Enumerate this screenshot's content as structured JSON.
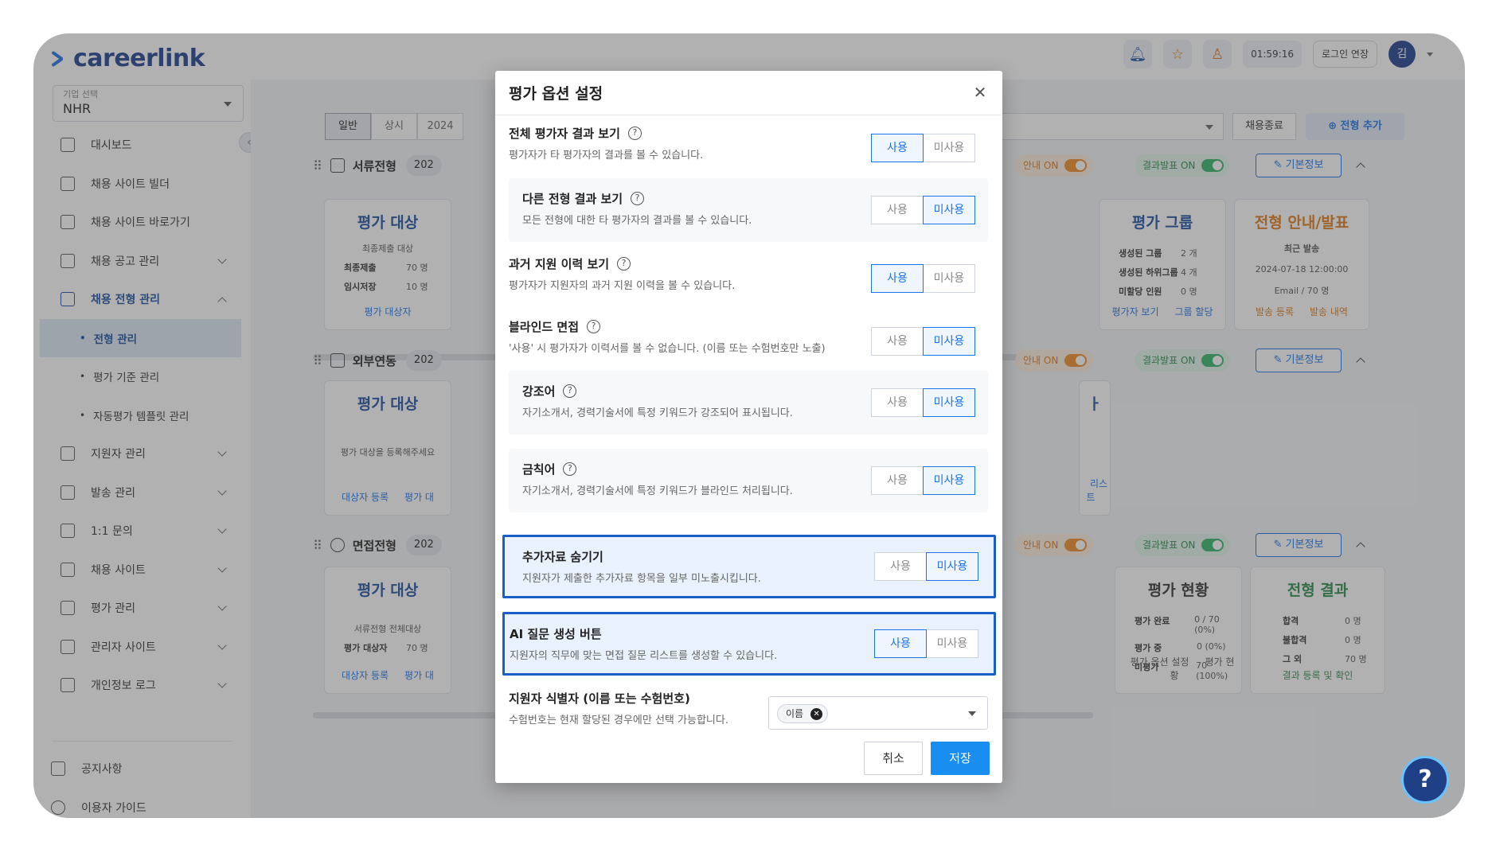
{
  "app": {
    "logo_text": "careerlink"
  },
  "company_select": {
    "label": "기업 선택",
    "value": "NHR"
  },
  "sidebar": {
    "items": [
      {
        "label": "대시보드",
        "icon": "chart-icon"
      },
      {
        "label": "채용 사이트 빌더",
        "icon": "builder-icon"
      },
      {
        "label": "채용 사이트 바로가기",
        "icon": "home-icon"
      },
      {
        "label": "채용 공고 관리",
        "icon": "list-icon"
      },
      {
        "label": "채용 전형 관리",
        "icon": "clipboard-icon"
      }
    ],
    "sub_items": [
      {
        "label": "전형 관리"
      },
      {
        "label": "평가 기준 관리"
      },
      {
        "label": "자동평가 템플릿 관리"
      }
    ],
    "items_after": [
      {
        "label": "지원자 관리",
        "icon": "users-icon"
      },
      {
        "label": "발송 관리",
        "icon": "mail-icon"
      },
      {
        "label": "1:1 문의",
        "icon": "chat-icon"
      },
      {
        "label": "채용 사이트",
        "icon": "calendar-icon"
      },
      {
        "label": "평가 관리",
        "icon": "ab-icon"
      },
      {
        "label": "관리자 사이트",
        "icon": "admin-icon"
      },
      {
        "label": "개인정보 로그",
        "icon": "history-icon"
      }
    ],
    "bottom": [
      {
        "label": "공지사항",
        "icon": "megaphone-icon"
      },
      {
        "label": "이용자 가이드",
        "icon": "question-icon"
      }
    ]
  },
  "header": {
    "timer": "01:59:16",
    "login_extend": "로그인 연장",
    "avatar_initial": "김"
  },
  "toolbar": {
    "tabs": [
      "일반",
      "상시",
      "2024"
    ],
    "end_button": "채용종료",
    "add_button": "전형 추가"
  },
  "sections": [
    {
      "title": "서류전형",
      "year": "202"
    },
    {
      "title": "외부연동",
      "year": "202"
    },
    {
      "title": "면접전형",
      "year": "202"
    }
  ],
  "section_controls": {
    "guide_toggle": "안내 ON",
    "result_toggle": "결과발표 ON",
    "basic_info": "기본정보"
  },
  "cards": {
    "eval_target": "평가 대상",
    "final_target": "최종제출 대상",
    "final_submit": "최종제출",
    "final_submit_val": "70 명",
    "temp_save": "임시저장",
    "temp_save_val": "10 명",
    "eval_target_link": "평가 대상자",
    "register_prompt": "평가 대상을 등록해주세요",
    "target_register": "대상자 등록",
    "target_link_partial": "평가 대",
    "doc_all_target": "서류전형 전체대상",
    "eval_target_person": "평가 대상자",
    "eval_target_person_val": "70 명",
    "eval_group": "평가 그룹",
    "created_group": "생성된 그룹",
    "created_group_val": "2 개",
    "created_subgroup": "생성된 하위그룹",
    "created_subgroup_val": "4 개",
    "unassigned": "미할당 인원",
    "unassigned_val": "0 명",
    "evaluator_view": "평가자 보기",
    "group_assign": "그룹 할당",
    "guide_announce": "전형 안내/발표",
    "recent_send": "최근 발송",
    "recent_date": "2024-07-18 12:00:00",
    "email_count": "Email / 70 명",
    "send_register": "발송 등록",
    "send_history": "발송 내역",
    "partial_title": "ㅏ",
    "partial_link": "리스트",
    "eval_status": "평가 현황",
    "eval_done": "평가 완료",
    "eval_done_val": "0 / 70 (0%)",
    "eval_ing": "평가 중",
    "eval_ing_val": "0 (0%)",
    "not_eval": "미평가",
    "not_eval_val": "70 (100%)",
    "eval_option_setting": "평가 옵션 설정",
    "eval_status_link": "평가 현황",
    "stage_result": "전형 결과",
    "pass": "합격",
    "pass_val": "0 명",
    "fail": "불합격",
    "fail_val": "0 명",
    "etc": "그 외",
    "etc_val": "70 명",
    "result_register": "결과 등록 및 확인"
  },
  "modal": {
    "title": "평가 옵션 설정",
    "on_label": "사용",
    "off_label": "미사용",
    "options": [
      {
        "title": "전체 평가자 결과 보기",
        "desc": "평가자가 타 평가자의 결과를 볼 수 있습니다.",
        "selected": "사용"
      },
      {
        "title": "다른 전형 결과 보기",
        "desc": "모든 전형에 대한 타 평가자의 결과를 볼 수 있습니다.",
        "selected": "미사용"
      },
      {
        "title": "과거 지원 이력 보기",
        "desc": "평가자가 지원자의 과거 지원 이력을 볼 수 있습니다.",
        "selected": "사용"
      },
      {
        "title": "블라인드 면접",
        "desc": "'사용' 시 평가자가 이력서를 볼 수 없습니다. (이름 또는 수험번호만 노출)",
        "selected": "미사용"
      },
      {
        "title": "강조어",
        "desc": "자기소개서, 경력기술서에 특정 키워드가 강조되어 표시됩니다.",
        "selected": "미사용"
      },
      {
        "title": "금칙어",
        "desc": "자기소개서, 경력기술서에 특정 키워드가 블라인드 처리됩니다.",
        "selected": "미사용"
      },
      {
        "title": "추가자료 숨기기",
        "desc": "지원자가 제출한 추가자료 항목을 일부 미노출시킵니다.",
        "selected": "미사용"
      },
      {
        "title": "AI 질문 생성 버튼",
        "desc": "지원자의 직무에 맞는 면접 질문 리스트를 생성할 수 있습니다.",
        "selected": "사용"
      }
    ],
    "identifier": {
      "title": "지원자 식별자 (이름 또는 수험번호)",
      "desc": "수험번호는 현재 할당된 경우에만 선택 가능합니다.",
      "chip": "이름"
    },
    "cancel": "취소",
    "save": "저장"
  },
  "help_fab": "?"
}
